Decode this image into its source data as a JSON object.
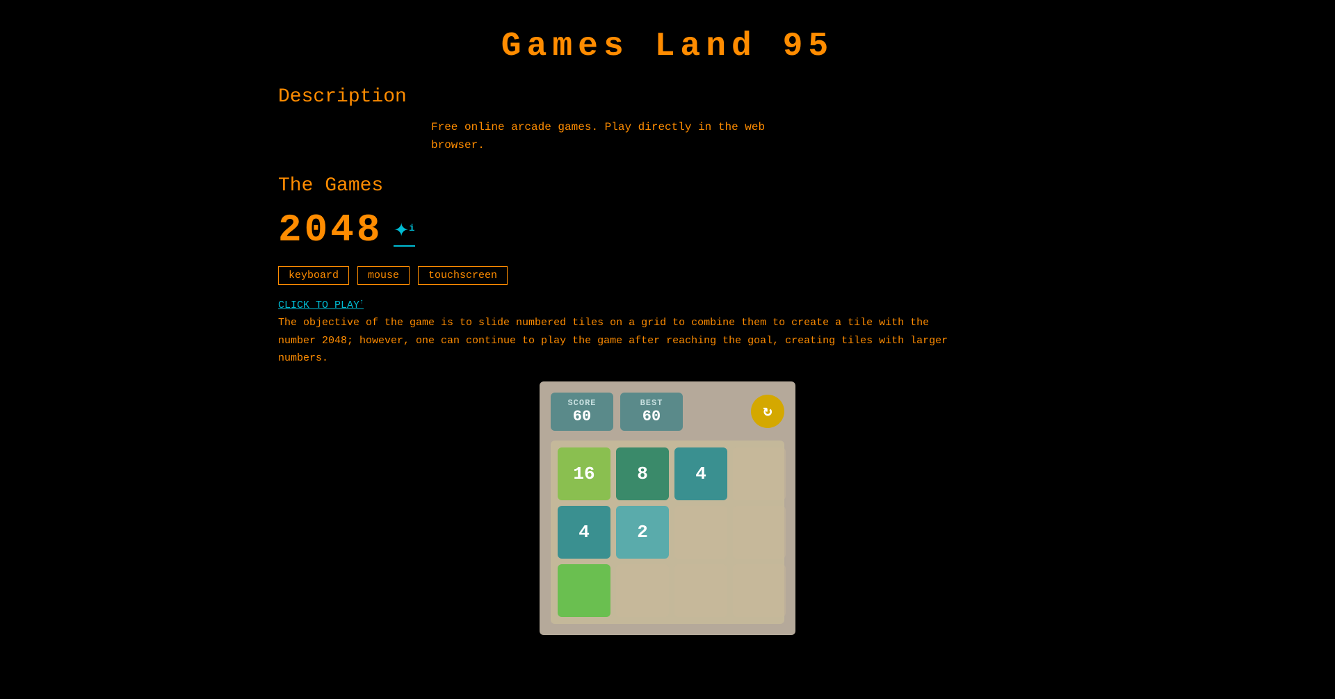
{
  "site": {
    "title": "Games Land 95"
  },
  "description_section": {
    "heading": "Description",
    "text_line1": "Free online arcade games. Play directly in the web",
    "text_line2": "browser."
  },
  "games_section": {
    "heading": "The Games",
    "game": {
      "title": "2048",
      "icon_symbol": "✦",
      "icon_superscript": "i",
      "tags": [
        "keyboard",
        "mouse",
        "touchscreen"
      ],
      "click_to_play_label": "CLICK TO PLAY",
      "click_to_play_superscript": "↑",
      "description": "The objective of the game is to slide numbered tiles on a grid to combine them to create a tile with\nthe number 2048; however, one can continue to play the game after reaching the goal, creating tiles\nwith larger numbers."
    }
  },
  "game_preview": {
    "score_label": "SCORE",
    "score_value": "60",
    "best_label": "BEST",
    "best_value": "60",
    "refresh_icon": "G",
    "tiles": [
      {
        "value": "16",
        "type": "tile-16"
      },
      {
        "value": "8",
        "type": "tile-8"
      },
      {
        "value": "4",
        "type": "tile-4"
      },
      {
        "value": "",
        "type": "tile-empty"
      },
      {
        "value": "4",
        "type": "tile-4"
      },
      {
        "value": "2",
        "type": "tile-2"
      },
      {
        "value": "",
        "type": "tile-empty"
      },
      {
        "value": "",
        "type": "tile-empty"
      }
    ]
  },
  "colors": {
    "orange": "#ff8c00",
    "cyan": "#00bcd4",
    "background": "#000000"
  }
}
